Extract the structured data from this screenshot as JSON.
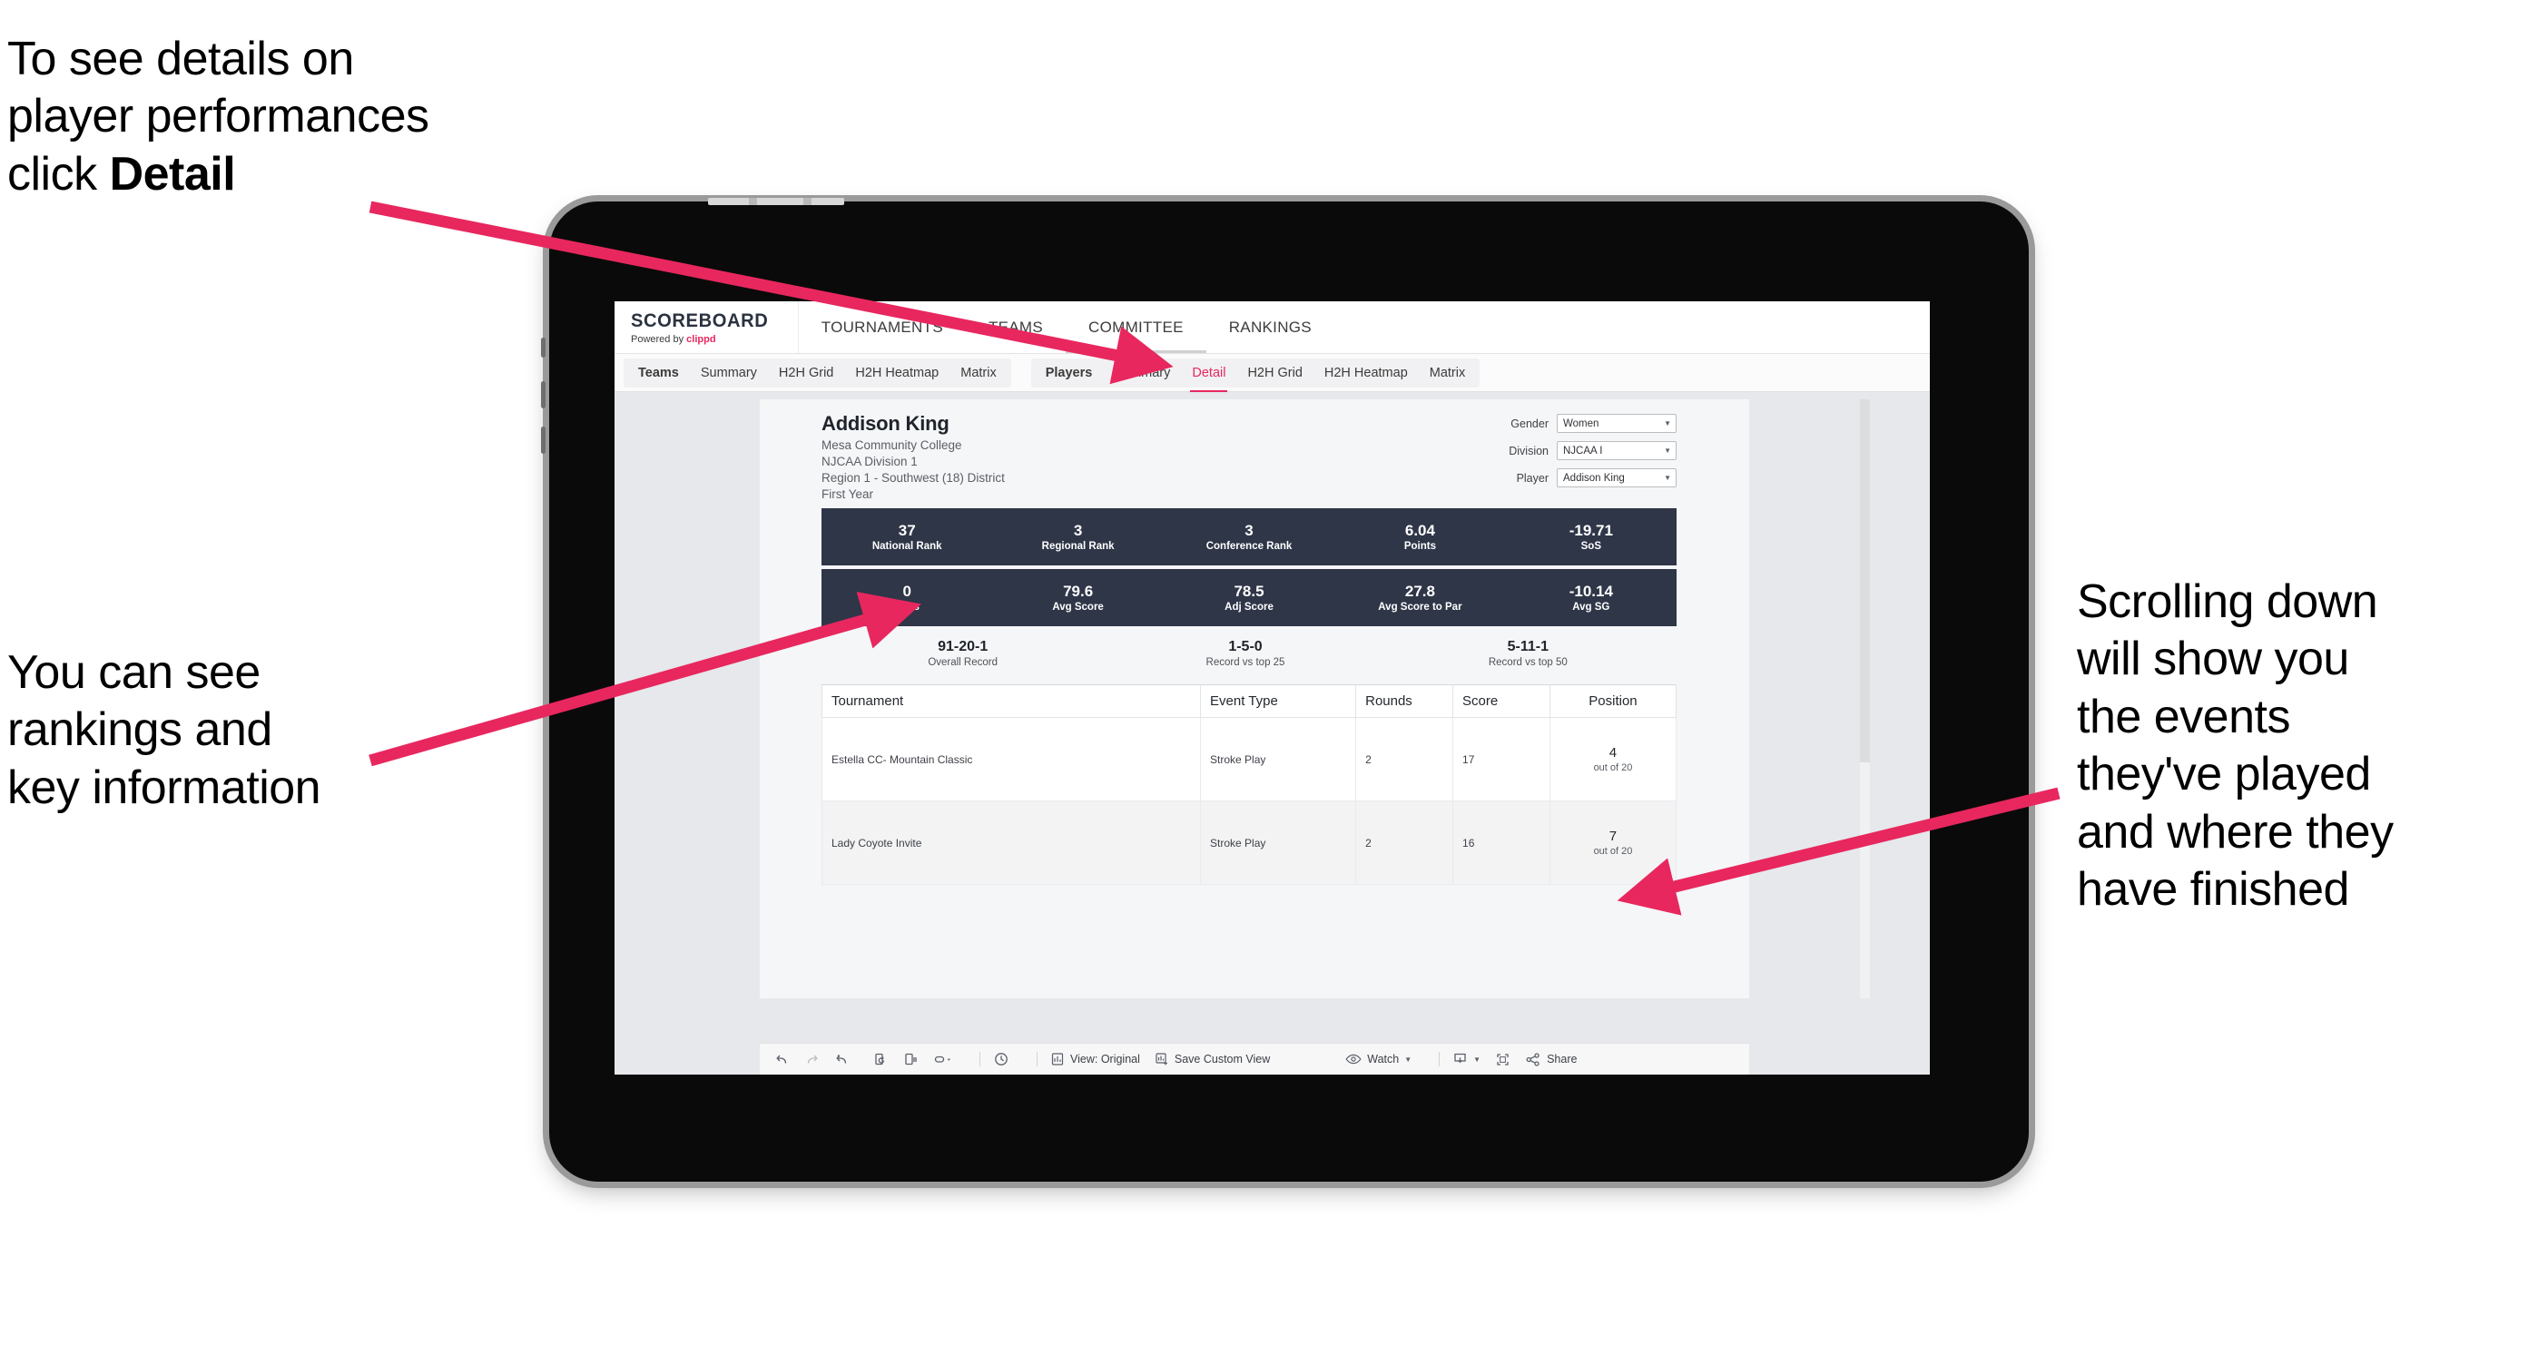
{
  "annotations": {
    "top_left": "To see details on\nplayer performances\nclick ",
    "top_left_bold": "Detail",
    "mid_left": "You can see\nrankings and\nkey information",
    "right": "Scrolling down\nwill show you\nthe events\nthey've played\nand where they\nhave finished",
    "arrow_color": "#e8275f"
  },
  "app": {
    "brand": {
      "title": "SCOREBOARD",
      "powered_prefix": "Powered by ",
      "powered_name": "clippd"
    },
    "nav": [
      {
        "label": "TOURNAMENTS"
      },
      {
        "label": "TEAMS"
      },
      {
        "label": "COMMITTEE"
      },
      {
        "label": "RANKINGS"
      }
    ],
    "subnav": {
      "teams_group": [
        {
          "label": "Teams",
          "head": true
        },
        {
          "label": "Summary"
        },
        {
          "label": "H2H Grid"
        },
        {
          "label": "H2H Heatmap"
        },
        {
          "label": "Matrix"
        }
      ],
      "players_group": [
        {
          "label": "Players",
          "head": true
        },
        {
          "label": "Summary"
        },
        {
          "label": "Detail",
          "selected": true
        },
        {
          "label": "H2H Grid"
        },
        {
          "label": "H2H Heatmap"
        },
        {
          "label": "Matrix"
        }
      ]
    }
  },
  "player": {
    "name": "Addison King",
    "school": "Mesa Community College",
    "division": "NJCAA Division 1",
    "region": "Region 1 - Southwest (18) District",
    "year": "First Year"
  },
  "filters": [
    {
      "label": "Gender",
      "value": "Women"
    },
    {
      "label": "Division",
      "value": "NJCAA I"
    },
    {
      "label": "Player",
      "value": "Addison King"
    }
  ],
  "stats_row_1": [
    {
      "value": "37",
      "label": "National Rank"
    },
    {
      "value": "3",
      "label": "Regional Rank"
    },
    {
      "value": "3",
      "label": "Conference Rank"
    },
    {
      "value": "6.04",
      "label": "Points"
    },
    {
      "value": "-19.71",
      "label": "SoS"
    }
  ],
  "stats_row_2": [
    {
      "value": "0",
      "label": "Wins"
    },
    {
      "value": "79.6",
      "label": "Avg Score"
    },
    {
      "value": "78.5",
      "label": "Adj Score"
    },
    {
      "value": "27.8",
      "label": "Avg Score to Par"
    },
    {
      "value": "-10.14",
      "label": "Avg SG"
    }
  ],
  "records": [
    {
      "value": "91-20-1",
      "label": "Overall Record"
    },
    {
      "value": "1-5-0",
      "label": "Record vs top 25"
    },
    {
      "value": "5-11-1",
      "label": "Record vs top 50"
    }
  ],
  "events_table": {
    "columns": [
      "Tournament",
      "Event Type",
      "Rounds",
      "Score",
      "Position"
    ],
    "rows": [
      {
        "tournament": "Estella CC- Mountain Classic",
        "event_type": "Stroke Play",
        "rounds": "2",
        "score": "17",
        "position_value": "4",
        "position_label": "out of 20"
      },
      {
        "tournament": "Lady Coyote Invite",
        "event_type": "Stroke Play",
        "rounds": "2",
        "score": "16",
        "position_value": "7",
        "position_label": "out of 20"
      }
    ]
  },
  "toolbar": {
    "view_label": "View: Original",
    "save_label": "Save Custom View",
    "watch_label": "Watch",
    "share_label": "Share"
  },
  "colors": {
    "accent_pink": "#e8275f",
    "stat_navy": "#2f3648",
    "canvas_grey": "#e6e8eb"
  }
}
